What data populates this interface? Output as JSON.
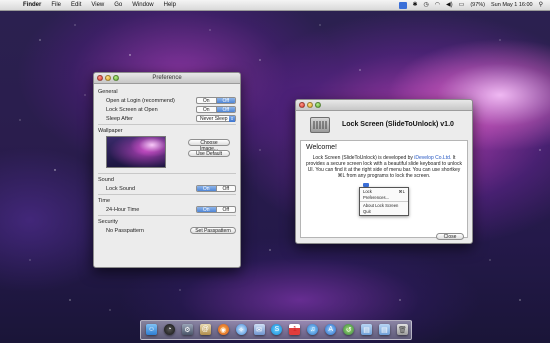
{
  "menubar": {
    "apple": "",
    "items": [
      "Finder",
      "File",
      "Edit",
      "View",
      "Go",
      "Window",
      "Help"
    ],
    "battery": "(97%)",
    "datetime": "Sun May 1  16:00"
  },
  "preference": {
    "title": "Preference",
    "general_label": "General",
    "rows": [
      {
        "label": "Open at Login (recommend)",
        "on": "On",
        "off": "Off"
      },
      {
        "label": "Lock Screen at Open",
        "on": "On",
        "off": "Off"
      }
    ],
    "sleep_after_label": "Sleep After",
    "sleep_after_value": "Never Sleep",
    "wallpaper_label": "Wallpaper",
    "choose_image": "Choose Image...",
    "use_default": "Use Default",
    "sound_label": "Sound",
    "lock_sound_label": "Lock Sound",
    "time_label": "Time",
    "hour24_label": "24-Hour Time",
    "security_label": "Security",
    "no_passpattern": "No Passpattern",
    "set_passpattern": "Set Passpattern",
    "on": "On",
    "off": "Off"
  },
  "lockscreen": {
    "title": "Lock Screen (SlideToUnlock) v1.0",
    "welcome": "Welcome!",
    "desc_1": "Lock Screen (SlideToUnlock) is developed by ",
    "developer": "iDevelop Co.Ltd.",
    "desc_2": "It provides a secure screen lock with a beautiful slide keyboard to unlock UI. You can find it at the right side of menu bar. You can use shortkey ⌘L from any programs to lock the screen.",
    "menu": {
      "lock": "Lock",
      "lock_shortcut": "⌘L",
      "preferences": "Preferences...",
      "about": "About Lock Screen",
      "quit": "Quit"
    },
    "close_button": "Close"
  },
  "dock": {
    "icons": [
      "finder-icon",
      "dashboard-icon",
      "system-icon",
      "address-book-icon",
      "firefox-icon",
      "safari-icon",
      "mail-icon",
      "skype-icon",
      "ical-icon",
      "itunes-icon",
      "app-store-icon",
      "time-machine-icon",
      "folder-icon",
      "folder-icon",
      "trash-icon"
    ]
  }
}
